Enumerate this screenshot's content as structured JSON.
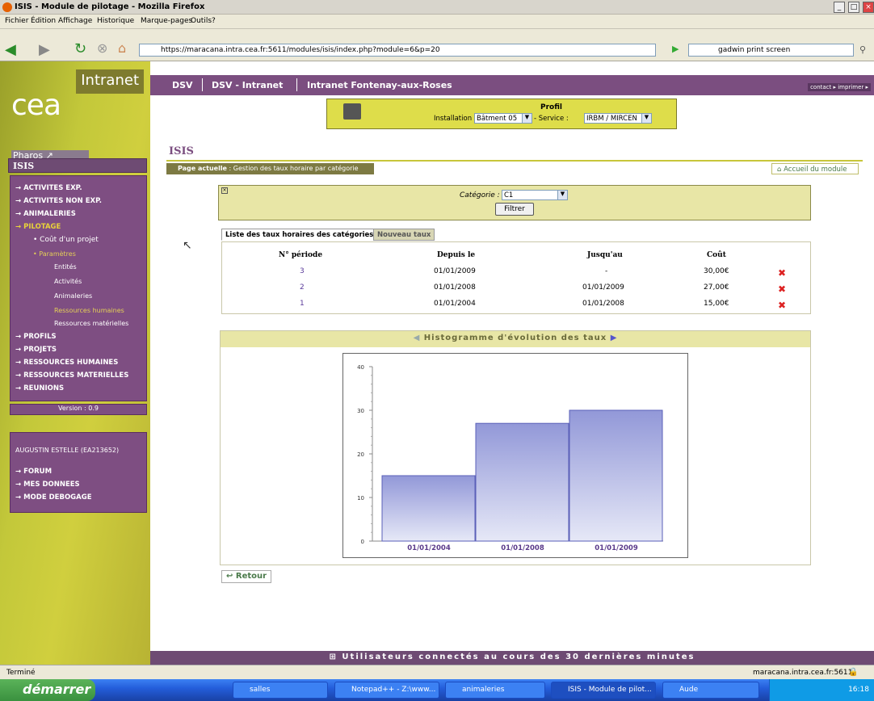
{
  "window": {
    "title": "ISIS - Module de pilotage - Mozilla Firefox"
  },
  "menu": [
    "Fichier",
    "Édition",
    "Affichage",
    "Historique",
    "Marque-pages",
    "Outils",
    "?"
  ],
  "browser": {
    "url": "https://maracana.intra.cea.fr:5611/modules/isis/index.php?module=6&p=20",
    "search": "gadwin print screen"
  },
  "sidebar": {
    "logo": "cea",
    "intranet": "Intranet",
    "pharos": "Pharos",
    "isis": "ISIS",
    "items": [
      {
        "label": "ACTIVITES EXP."
      },
      {
        "label": "ACTIVITES NON EXP."
      },
      {
        "label": "ANIMALERIES"
      },
      {
        "label": "PILOTAGE"
      }
    ],
    "pilotage_sub": [
      "Coût d'un projet",
      "Paramètres"
    ],
    "param_sub": [
      "Entités",
      "Activités",
      "Animaleries",
      "Ressources humaines",
      "Ressources matérielles"
    ],
    "items2": [
      {
        "label": "PROFILS"
      },
      {
        "label": "PROJETS"
      },
      {
        "label": "RESSOURCES HUMAINES"
      },
      {
        "label": "RESSOURCES MATERIELLES"
      },
      {
        "label": "REUNIONS"
      }
    ],
    "version": "Version : 0.9",
    "user": "AUGUSTIN ESTELLE (EA213652)",
    "user_items": [
      "FORUM",
      "MES DONNEES",
      "MODE DEBOGAGE"
    ]
  },
  "topbar": {
    "l1": "DSV",
    "l2": "DSV - Intranet",
    "l3": "Intranet Fontenay-aux-Roses",
    "contact": "contact ▸ imprimer ▸"
  },
  "profil": {
    "title": "Profil",
    "installation_label": "Installation :",
    "installation": "Bâtment 05",
    "service_label": "- Service :",
    "service": "IRBM / MIRCEN"
  },
  "page": {
    "title": "ISIS",
    "crumb_label": "Page actuelle",
    "crumb_text": " : Gestion des taux horaire par catégorie",
    "accueil": "Accueil du module",
    "categorie_label": "Catégorie :",
    "categorie": "C1",
    "filter": "Filtrer",
    "tab1": "Liste des taux horaires des catégories",
    "tab2": "Nouveau taux",
    "headers": [
      "N° période",
      "Depuis le",
      "Jusqu'au",
      "Coût"
    ],
    "rows": [
      {
        "periode": "3",
        "depuis": "01/01/2009",
        "jusqu": "-",
        "cout": "30,00€"
      },
      {
        "periode": "2",
        "depuis": "01/01/2008",
        "jusqu": "01/01/2009",
        "cout": "27,00€"
      },
      {
        "periode": "1",
        "depuis": "01/01/2004",
        "jusqu": "01/01/2008",
        "cout": "15,00€"
      }
    ],
    "hist_title": "Histogramme d'évolution des taux",
    "retour": "Retour",
    "footer": "Utilisateurs connectés au cours des 30 dernières minutes"
  },
  "chart_data": {
    "type": "bar",
    "categories": [
      "01/01/2004",
      "01/01/2008",
      "01/01/2009"
    ],
    "values": [
      15,
      27,
      30
    ],
    "ylim": [
      0,
      40
    ],
    "yticks": [
      0,
      10,
      20,
      30,
      40
    ],
    "colors": {
      "bar": "#b0b4e6",
      "barTop": "#9298d8"
    }
  },
  "status": {
    "left": "Terminé",
    "right": "maracana.intra.cea.fr:5611"
  },
  "taskbar": {
    "start": "démarrer",
    "tasks": [
      "salles",
      "Notepad++ - Z:\\www...",
      "animaleries",
      "ISIS - Module de pilot...",
      "Aude"
    ],
    "time": "16:18"
  }
}
